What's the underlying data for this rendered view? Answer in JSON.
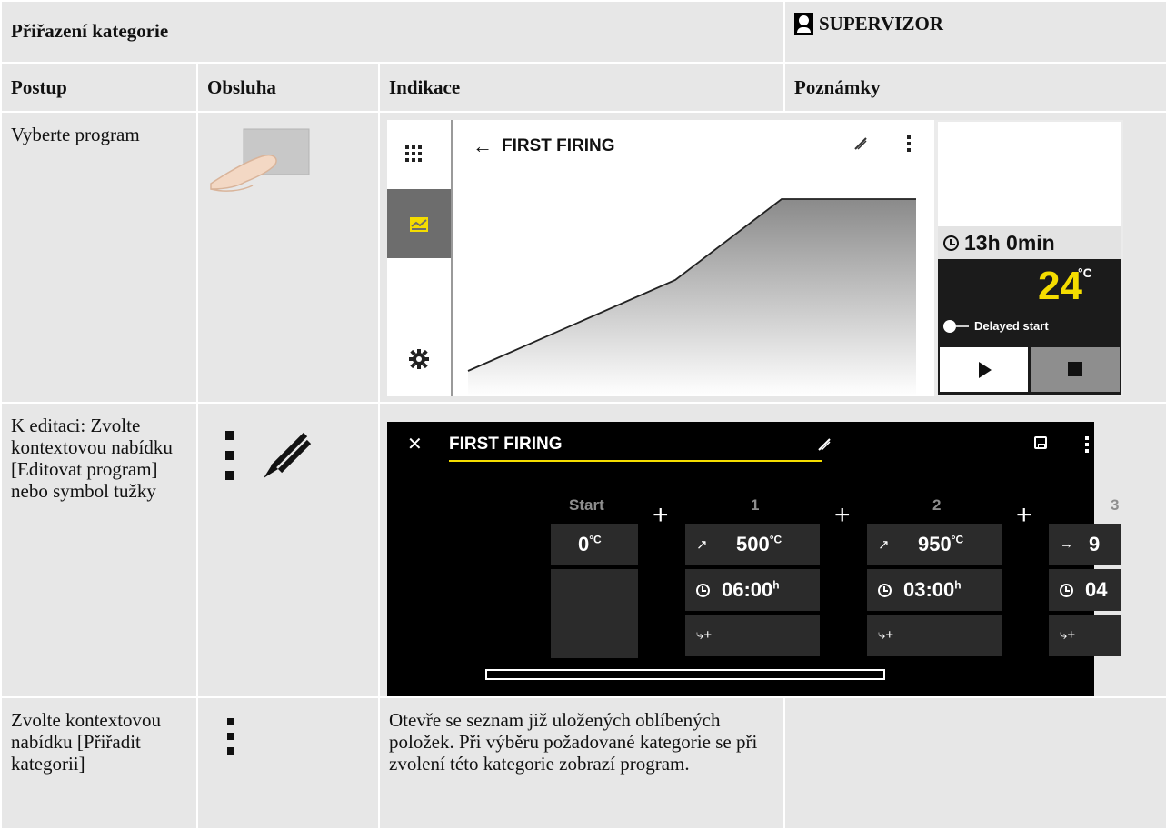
{
  "header": {
    "title": "Přiřazení kategorie",
    "role": "SUPERVIZOR"
  },
  "columns": {
    "step": "Postup",
    "operation": "Obsluha",
    "display": "Indikace",
    "notes": "Poznámky"
  },
  "rows": [
    {
      "step": "Vyberte program",
      "operation_icon": "finger-tap-icon"
    },
    {
      "step": "K editaci: Zvolte kontextovou nabídku [Editovat program] nebo symbol tužky",
      "operation_icons": [
        "kebab-menu-icon",
        "pencil-icon"
      ]
    },
    {
      "step": "Zvolte kontextovou nabídku [Přiřadit kategorii]",
      "operation_icon": "kebab-menu-icon",
      "display": "Otevře se seznam již uložených oblíbených položek. Při výběru požadované kategorie se při zvolení této kategorie zobrazí program.",
      "notes": ""
    }
  ],
  "screen1": {
    "program_name": "FIRST FIRING",
    "duration": "13h 0min",
    "temperature": "24",
    "temp_unit": "°C",
    "delayed_start_label": "Delayed start",
    "delayed_start_on": false
  },
  "screen2": {
    "program_name": "FIRST FIRING",
    "start_label": "Start",
    "start_temp": "0",
    "temp_unit": "°C",
    "time_unit": "h",
    "segments": [
      {
        "label": "1",
        "mode": "ramp",
        "temp": "500",
        "time": "06:00"
      },
      {
        "label": "2",
        "mode": "ramp",
        "temp": "950",
        "time": "03:00"
      },
      {
        "label": "3",
        "mode": "hold",
        "temp": "9",
        "time": "04"
      }
    ]
  },
  "colors": {
    "accent_yellow": "#f4dc00",
    "table_cell": "#e7e7e7",
    "table_header": "#d8d8d8"
  }
}
